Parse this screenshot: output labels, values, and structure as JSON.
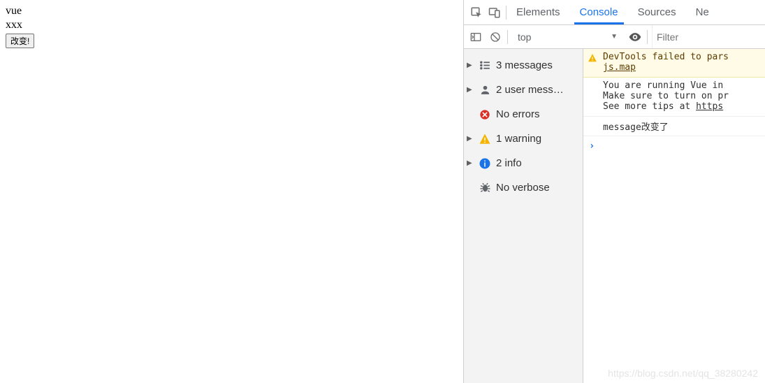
{
  "page": {
    "line1": "vue",
    "line2": "xxx",
    "button_label": "改变!"
  },
  "devtools": {
    "tabs": {
      "elements": "Elements",
      "console": "Console",
      "sources": "Sources",
      "network": "Ne"
    },
    "toolbar": {
      "context_selected": "top",
      "filter_placeholder": "Filter"
    },
    "sidebar": {
      "messages": "3 messages",
      "user_messages": "2 user mess…",
      "errors": "No errors",
      "warnings": "1 warning",
      "info": "2 info",
      "verbose": "No verbose"
    },
    "log": {
      "warn_text": "DevTools failed to pars",
      "warn_link": "js.map",
      "vue_line1": "You are running Vue in",
      "vue_line2": "Make sure to turn on pr",
      "vue_line3_pre": "See more tips at ",
      "vue_line3_link": "https",
      "user_msg": "message改变了",
      "prompt": "›"
    }
  },
  "watermark": "https://blog.csdn.net/qq_38280242"
}
